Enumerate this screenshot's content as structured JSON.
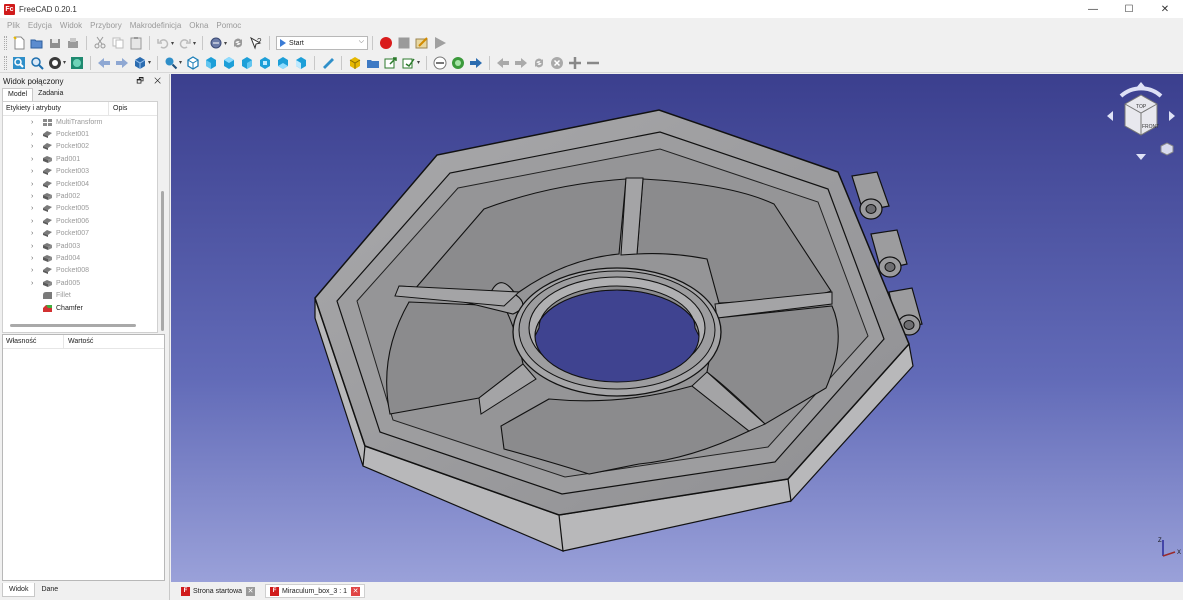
{
  "window": {
    "title": "FreeCAD 0.20.1",
    "logo": "Fc",
    "controls": [
      "—",
      "☐",
      "✕"
    ]
  },
  "menu": [
    "Plik",
    "Edycja",
    "Widok",
    "Przybory",
    "Makrodefinicja",
    "Okna",
    "Pomoc"
  ],
  "toolbar": {
    "macro_select": "Start"
  },
  "left_panel": {
    "title": "Widok połączony",
    "header_buttons": "🗗 ✕",
    "tabs": [
      "Model",
      "Zadania"
    ],
    "tree_columns": [
      "Etykiety i atrybuty",
      "Opis"
    ],
    "tree_items": [
      {
        "label": "MultiTransform",
        "type": "multitransform",
        "expandable": true,
        "dim": true
      },
      {
        "label": "Pocket001",
        "type": "pocket",
        "expandable": true,
        "dim": true
      },
      {
        "label": "Pocket002",
        "type": "pocket",
        "expandable": true,
        "dim": true
      },
      {
        "label": "Pad001",
        "type": "pad",
        "expandable": true,
        "dim": true
      },
      {
        "label": "Pocket003",
        "type": "pocket",
        "expandable": true,
        "dim": true
      },
      {
        "label": "Pocket004",
        "type": "pocket",
        "expandable": true,
        "dim": true
      },
      {
        "label": "Pad002",
        "type": "pad",
        "expandable": true,
        "dim": true
      },
      {
        "label": "Pocket005",
        "type": "pocket",
        "expandable": true,
        "dim": true
      },
      {
        "label": "Pocket006",
        "type": "pocket",
        "expandable": true,
        "dim": true
      },
      {
        "label": "Pocket007",
        "type": "pocket",
        "expandable": true,
        "dim": true
      },
      {
        "label": "Pad003",
        "type": "pad",
        "expandable": true,
        "dim": true
      },
      {
        "label": "Pad004",
        "type": "pad",
        "expandable": true,
        "dim": true
      },
      {
        "label": "Pocket008",
        "type": "pocket",
        "expandable": true,
        "dim": true
      },
      {
        "label": "Pad005",
        "type": "pad",
        "expandable": true,
        "dim": true
      },
      {
        "label": "Fillet",
        "type": "fillet",
        "expandable": false,
        "dim": true
      },
      {
        "label": "Chamfer",
        "type": "chamfer",
        "expandable": false,
        "dim": false
      }
    ],
    "prop_columns": [
      "Własność",
      "Wartość"
    ],
    "bottom_tabs": [
      "Widok",
      "Dane"
    ]
  },
  "navcube": {
    "top": "TOP",
    "front": "FRONT"
  },
  "axis": {
    "z": "Z",
    "x": "X"
  },
  "doc_tabs": [
    {
      "label": "Strona startowa",
      "active": false
    },
    {
      "label": "Miraculum_box_3 : 1",
      "active": true
    }
  ]
}
